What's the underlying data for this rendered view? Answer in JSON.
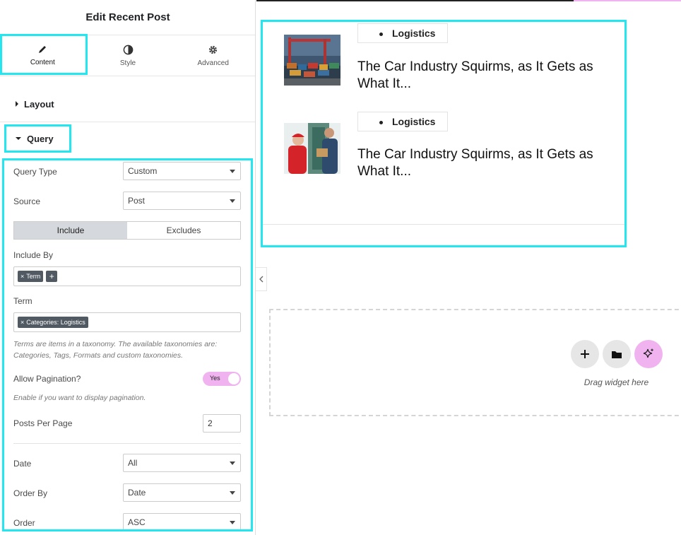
{
  "panel": {
    "title": "Edit Recent Post",
    "tabs": [
      {
        "label": "Content",
        "icon": "pencil-icon"
      },
      {
        "label": "Style",
        "icon": "contrast-icon"
      },
      {
        "label": "Advanced",
        "icon": "gear-icon"
      }
    ],
    "sections": {
      "layout": "Layout",
      "query": "Query"
    },
    "query": {
      "query_type": {
        "label": "Query Type",
        "value": "Custom"
      },
      "source": {
        "label": "Source",
        "value": "Post"
      },
      "segment": {
        "include": "Include",
        "excludes": "Excludes"
      },
      "include_by": {
        "label": "Include By",
        "tag": "Term",
        "add": "+"
      },
      "term": {
        "label": "Term",
        "tag": "Categories: Logistics"
      },
      "term_help": "Terms are items in a taxonomy. The available taxonomies are: Categories, Tags, Formats and custom taxonomies.",
      "pagination": {
        "label": "Allow Pagination?",
        "value": "Yes",
        "help": "Enable if you want to display pagination."
      },
      "posts_per_page": {
        "label": "Posts Per Page",
        "value": "2"
      },
      "date": {
        "label": "Date",
        "value": "All"
      },
      "order_by": {
        "label": "Order By",
        "value": "Date"
      },
      "order": {
        "label": "Order",
        "value": "ASC"
      }
    }
  },
  "posts": [
    {
      "category": "Logistics",
      "title": "The Car Industry Squirms, as It Gets as What It...",
      "image": "shipping-containers-image"
    },
    {
      "category": "Logistics",
      "title": "The Car Industry Squirms, as It Gets as What It...",
      "image": "delivery-workers-image"
    }
  ],
  "canvas": {
    "drag_text": "Drag widget here",
    "add_icon": "plus-icon",
    "folder_icon": "folder-icon",
    "ai_icon": "sparkle-icon"
  },
  "colors": {
    "highlight": "#22e6f0",
    "toggle": "#f0b3f0",
    "ai_button": "#f0b3f0"
  }
}
